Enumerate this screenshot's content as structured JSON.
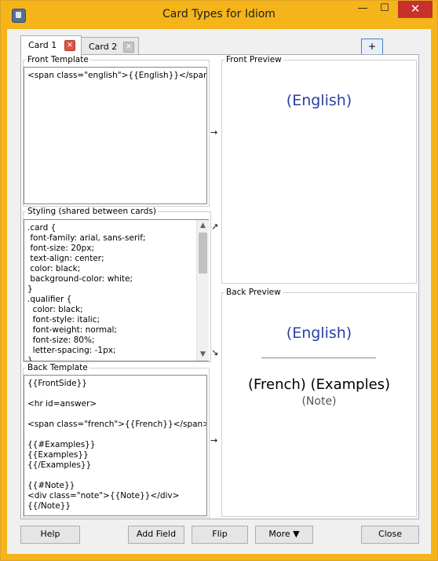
{
  "window": {
    "title": "Card Types for Idiom",
    "minimize": "—",
    "maximize": "☐",
    "close": "✕"
  },
  "tabs": [
    {
      "label": "Card 1",
      "close": "✕"
    },
    {
      "label": "Card 2",
      "close": "✕"
    }
  ],
  "add_tab_label": "+",
  "front_template": {
    "label": "Front Template",
    "text": "<span class=\"english\">{{English}}</span>"
  },
  "styling": {
    "label": "Styling (shared between cards)",
    "text": ".card {\n font-family: arial, sans-serif;\n font-size: 20px;\n text-align: center;\n color: black;\n background-color: white;\n}\n.qualifier {\n  color: black;\n  font-style: italic;\n  font-weight: normal;\n  font-size: 80%;\n  letter-spacing: -1px;\n}"
  },
  "back_template": {
    "label": "Back Template",
    "text": "{{FrontSide}}\n\n<hr id=answer>\n\n<span class=\"french\">{{French}}</span>\n\n{{#Examples}}\n{{Examples}}\n{{/Examples}}\n\n{{#Note}}\n<div class=\"note\">{{Note}}</div>\n{{/Note}}"
  },
  "indicators": {
    "front_arrow": "→",
    "styling_up": "↗",
    "styling_down": "↘",
    "back_arrow": "→"
  },
  "front_preview": {
    "label": "Front Preview",
    "english": "(English)"
  },
  "back_preview": {
    "label": "Back Preview",
    "english": "(English)",
    "french_examples": "(French) (Examples)",
    "note": "(Note)"
  },
  "buttons": {
    "help": "Help",
    "add_field": "Add Field",
    "flip": "Flip",
    "more": "More ▼",
    "close": "Close"
  },
  "colors": {
    "titlebar": "#f4b41a",
    "close_button": "#c7302b",
    "preview_text": "#2b3fa0"
  }
}
